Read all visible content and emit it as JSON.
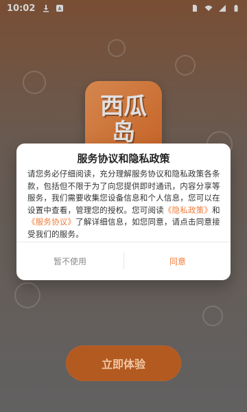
{
  "status_bar": {
    "time": "10:02",
    "left_icons": [
      "download-icon",
      "text-a-icon"
    ],
    "right_icons": [
      "sim-card-icon",
      "wifi-icon",
      "signal-icon",
      "battery-icon"
    ]
  },
  "app": {
    "logo_text_line1": "西瓜",
    "logo_text_line2": "岛"
  },
  "dialog": {
    "title": "服务协议和隐私政策",
    "body_part1": "请您务必仔细阅读，充分理解服务协议和隐私政策各条款，包括但不限于为了向您提供即时通讯，内容分享等服务，我们需要收集您设备信息和个人信息，您可以在设置中查看，管理您的授权。您可阅读",
    "link_privacy": "《隐私政策》",
    "body_part2": "和",
    "link_service": "《服务协议》",
    "body_part3": "了解详细信息，如您同意，请点击同意接受我们的服务。",
    "btn_deny": "暂不使用",
    "btn_agree": "同意"
  },
  "cta": {
    "label": "立即体验"
  },
  "colors": {
    "accent": "#ef7d3c",
    "cta_bg": "#b35a21",
    "logo_orange": "#e0712c"
  }
}
